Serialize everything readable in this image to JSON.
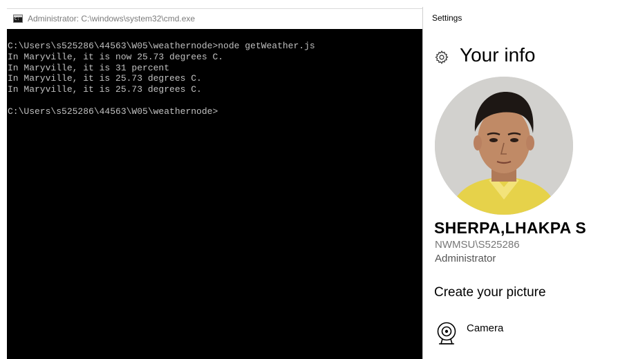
{
  "cmd": {
    "title": "Administrator: C:\\windows\\system32\\cmd.exe",
    "console_text": "C:\\Users\\s525286\\44563\\W05\\weathernode>node getWeather.js\nIn Maryville, it is now 25.73 degrees C.\nIn Maryville, it is 31 percent\nIn Maryville, it is 25.73 degrees C.\nIn Maryville, it is 25.73 degrees C.\n\nC:\\Users\\s525286\\44563\\W05\\weathernode>"
  },
  "settings": {
    "window_title": "Settings",
    "page_title": "Your info",
    "user": {
      "display_name": "SHERPA,LHAKPA S",
      "account": "NWMSU\\S525286",
      "role": "Administrator"
    },
    "create_picture": {
      "heading": "Create your picture",
      "camera_label": "Camera"
    }
  },
  "icons": {
    "cmd": "command-prompt-icon",
    "gear": "gear-icon",
    "camera": "webcam-icon"
  },
  "colors": {
    "console_bg": "#000000",
    "console_fg": "#c0c0c0",
    "muted_text": "#777777"
  }
}
